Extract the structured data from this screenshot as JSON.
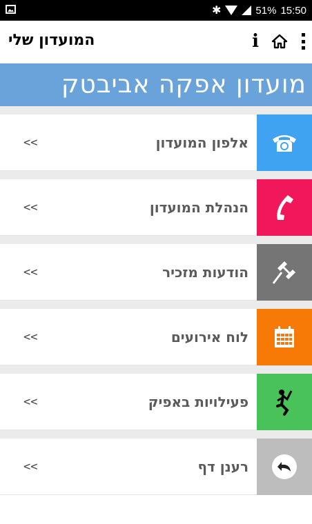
{
  "status": {
    "battery": "51%",
    "time": "15:50"
  },
  "appbar": {
    "title": "המועדון שלי",
    "info_glyph": "i"
  },
  "banner": {
    "text": "מועדון אפקה אביבטק"
  },
  "menu": {
    "items": [
      {
        "label": "אלפון המועדון",
        "arrow": "<<",
        "color": "#3fa3f2",
        "icon": "phone-icon"
      },
      {
        "label": "הנהלת המועדון",
        "arrow": "<<",
        "color": "#f0175a",
        "icon": "handset-icon"
      },
      {
        "label": "הודעות מזכיר",
        "arrow": "<<",
        "color": "#757575",
        "icon": "pin-icon"
      },
      {
        "label": "לוח אירועים",
        "arrow": "<<",
        "color": "#f77a06",
        "icon": "calendar-icon"
      },
      {
        "label": "פעילויות באפיק",
        "arrow": "<<",
        "color": "#4ac25a",
        "icon": "runner-icon"
      },
      {
        "label": "רענן דף",
        "arrow": "<<",
        "color": "#bdbdbd",
        "icon": "refresh-icon"
      }
    ]
  }
}
